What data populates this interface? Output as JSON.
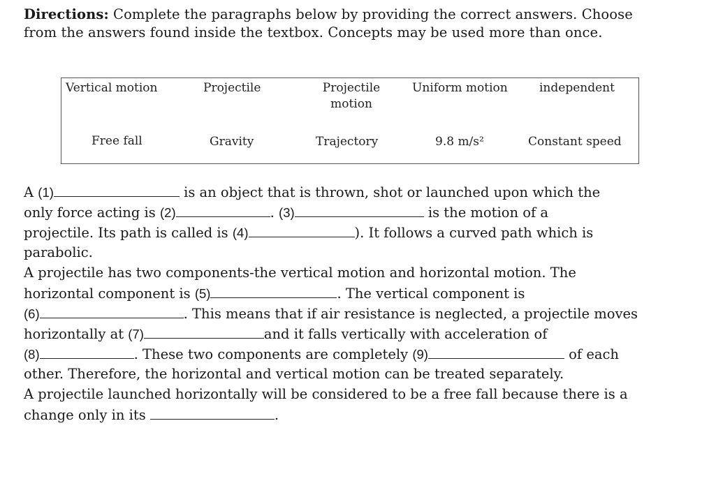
{
  "directions": {
    "label": "Directions:",
    "line1": " Complete the paragraphs below by providing the correct answers. Choose",
    "line2": "from the answers found inside the textbox. Concepts may be used more than once."
  },
  "answer_box": {
    "row1": [
      "Vertical motion",
      "Projectile",
      "Projectile motion",
      "Uniform motion",
      "independent"
    ],
    "row2": [
      "Free fall",
      "Gravity",
      "Trajectory",
      "9.8 m/s²",
      "Constant speed"
    ]
  },
  "paragraph1": {
    "l1_a": "A ",
    "n1": "(1)",
    "l1_b": " is an object that is thrown, shot or launched upon which the",
    "l2_a": "only force acting is ",
    "n2": "(2)",
    "l2_b": ". ",
    "n3": "(3)",
    "l2_c": " is the motion of a",
    "l3_a": "projectile. Its path is called is ",
    "n4": "(4)",
    "l3_b": "). It follows a curved path which is",
    "l4": "parabolic."
  },
  "paragraph2": {
    "l1": "A projectile has two components-the vertical motion and horizontal motion. The",
    "l2_a": "horizontal component is ",
    "n5": "(5)",
    "l2_b": ". The vertical component is",
    "n6": "(6)",
    "l3_b": ". This means that if air resistance is neglected, a projectile moves",
    "l4_a": "horizontally at ",
    "n7": "(7)",
    "l4_b": "and it falls vertically with acceleration of",
    "n8": "(8)",
    "l5_b": ". These two components are completely ",
    "n9": "(9)",
    "l5_c": " of each",
    "l6": "other. Therefore, the horizontal and vertical motion can be treated separately."
  },
  "paragraph3": {
    "l1": "A projectile launched horizontally will be considered to be a free fall because there is a",
    "l2_a": "change only in its ",
    "l2_b": "."
  }
}
